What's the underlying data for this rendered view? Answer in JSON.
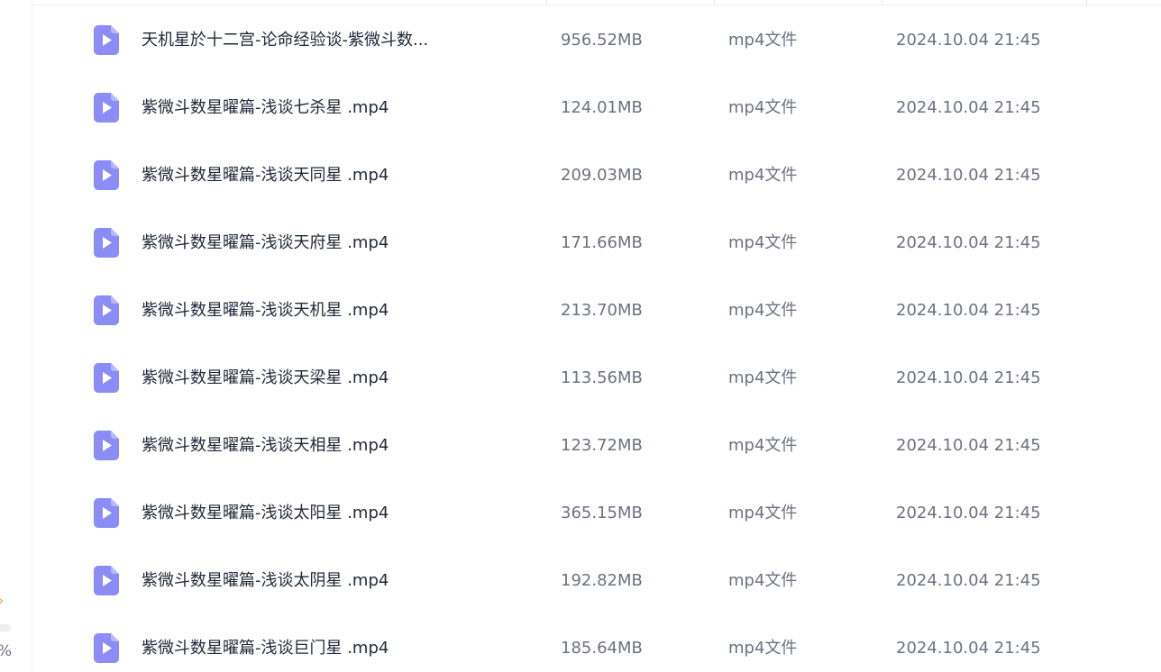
{
  "sidebar": {
    "chevron": "›",
    "percent": "%",
    "accent_color": "#f6a35a"
  },
  "files": [
    {
      "name": "天机星於十二宫-论命经验谈-紫微斗数...",
      "size": "956.52MB",
      "type": "mp4文件",
      "modified": "2024.10.04 21:45",
      "icon": "video-file-icon"
    },
    {
      "name": "紫微斗数星曜篇-浅谈七杀星 .mp4",
      "size": "124.01MB",
      "type": "mp4文件",
      "modified": "2024.10.04 21:45",
      "icon": "video-file-icon"
    },
    {
      "name": "紫微斗数星曜篇-浅谈天同星 .mp4",
      "size": "209.03MB",
      "type": "mp4文件",
      "modified": "2024.10.04 21:45",
      "icon": "video-file-icon"
    },
    {
      "name": "紫微斗数星曜篇-浅谈天府星 .mp4",
      "size": "171.66MB",
      "type": "mp4文件",
      "modified": "2024.10.04 21:45",
      "icon": "video-file-icon"
    },
    {
      "name": "紫微斗数星曜篇-浅谈天机星 .mp4",
      "size": "213.70MB",
      "type": "mp4文件",
      "modified": "2024.10.04 21:45",
      "icon": "video-file-icon"
    },
    {
      "name": "紫微斗数星曜篇-浅谈天梁星 .mp4",
      "size": "113.56MB",
      "type": "mp4文件",
      "modified": "2024.10.04 21:45",
      "icon": "video-file-icon"
    },
    {
      "name": "紫微斗数星曜篇-浅谈天相星 .mp4",
      "size": "123.72MB",
      "type": "mp4文件",
      "modified": "2024.10.04 21:45",
      "icon": "video-file-icon"
    },
    {
      "name": "紫微斗数星曜篇-浅谈太阳星 .mp4",
      "size": "365.15MB",
      "type": "mp4文件",
      "modified": "2024.10.04 21:45",
      "icon": "video-file-icon"
    },
    {
      "name": "紫微斗数星曜篇-浅谈太阴星 .mp4",
      "size": "192.82MB",
      "type": "mp4文件",
      "modified": "2024.10.04 21:45",
      "icon": "video-file-icon"
    },
    {
      "name": "紫微斗数星曜篇-浅谈巨门星 .mp4",
      "size": "185.64MB",
      "type": "mp4文件",
      "modified": "2024.10.04 21:45",
      "icon": "video-file-icon"
    }
  ]
}
